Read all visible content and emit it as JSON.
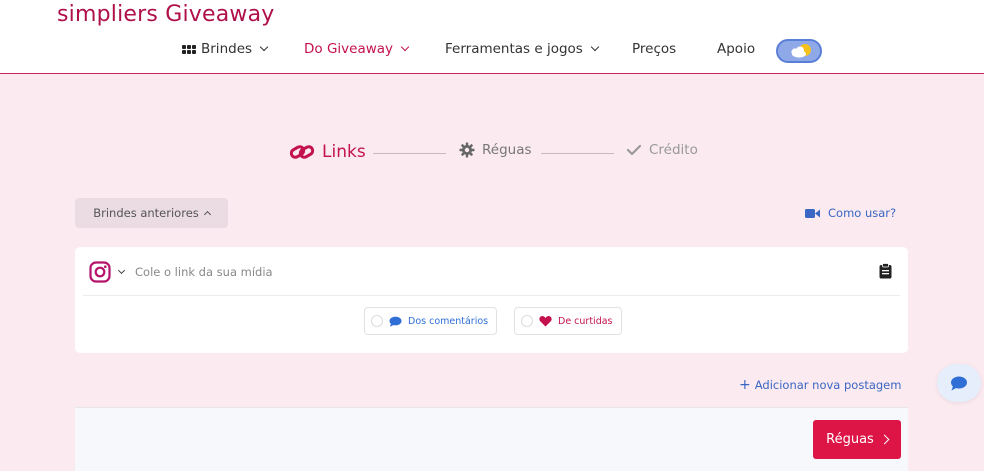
{
  "brand": {
    "name": "simpliers Giveaway"
  },
  "nav": {
    "items": [
      {
        "label": "Brindes",
        "icon": "grid-icon",
        "has_dropdown": true
      },
      {
        "label": "Do Giveaway",
        "has_dropdown": true,
        "active": true
      },
      {
        "label": "Ferramentas e jogos",
        "has_dropdown": true
      },
      {
        "label": "Preços"
      },
      {
        "label": "Apoio"
      }
    ],
    "theme_toggle": {
      "icon": "sun-cloud-icon"
    }
  },
  "steps": [
    {
      "label": "Links",
      "icon": "link-icon",
      "state": "active"
    },
    {
      "label": "Réguas",
      "icon": "gear-icon",
      "state": "pending"
    },
    {
      "label": "Crédito",
      "icon": "check-icon",
      "state": "pending"
    }
  ],
  "previous_giveaways": {
    "label": "Brindes anteriores"
  },
  "how_to_use": {
    "label": "Como usar?",
    "icon": "video-camera-icon"
  },
  "link_card": {
    "platform_icon": "instagram-icon",
    "input": {
      "placeholder": "Cole o link da sua mídia",
      "value": ""
    },
    "paste_icon": "clipboard-icon",
    "options": [
      {
        "label": "Dos comentários",
        "icon": "comment-icon",
        "color": "#2f6fd6"
      },
      {
        "label": "De curtidas",
        "icon": "heart-icon",
        "color": "#c4124e"
      }
    ]
  },
  "add_post": {
    "label": "Adicionar nova postagem"
  },
  "next_button": {
    "label": "Réguas"
  },
  "chat_button": {
    "icon": "chat-icon"
  },
  "colors": {
    "accent": "#c4124e",
    "button": "#dd1547",
    "link": "#3a66c4",
    "background": "#fbeaf0"
  }
}
